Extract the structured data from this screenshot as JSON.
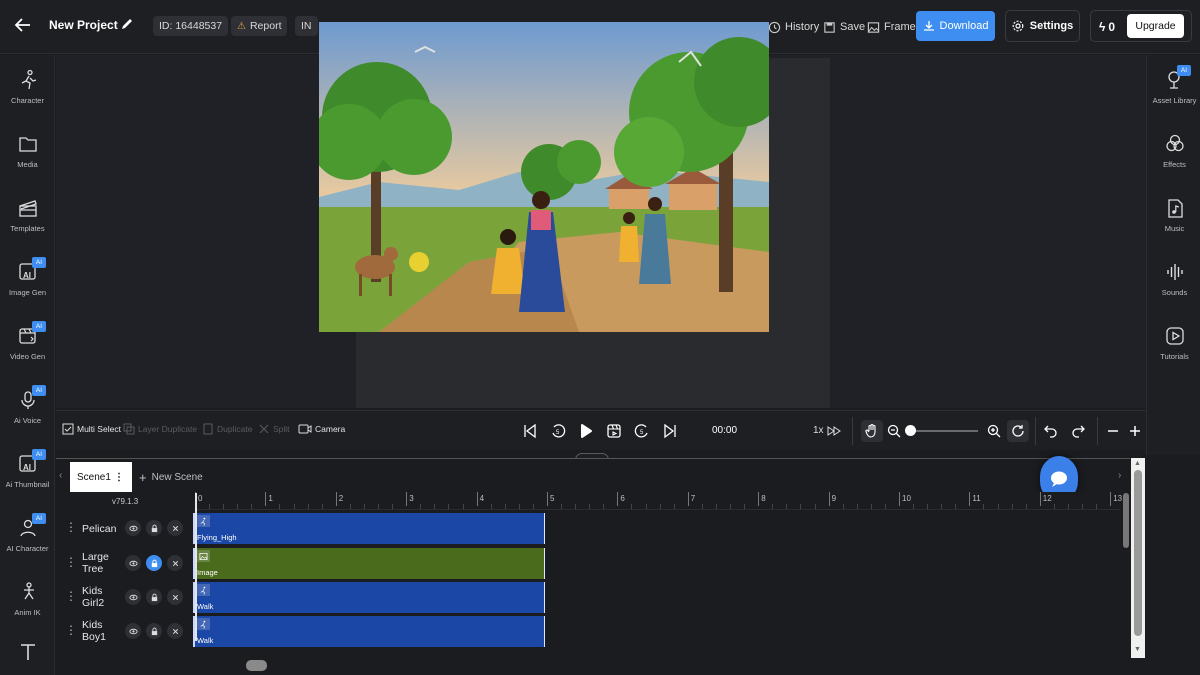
{
  "header": {
    "project_title": "New Project",
    "project_id": "ID: 16448537",
    "report_label": "Report",
    "lang_badge": "IN",
    "history_label": "History",
    "save_label": "Save",
    "frame_label": "Frame",
    "download_label": "Download",
    "settings_label": "Settings",
    "credits": "0",
    "upgrade_label": "Upgrade"
  },
  "left_sidebar": {
    "items": [
      {
        "label": "Character",
        "icon": "running-figure-icon",
        "ai": false
      },
      {
        "label": "Media",
        "icon": "folder-icon",
        "ai": false
      },
      {
        "label": "Templates",
        "icon": "clapperboard-icon",
        "ai": false
      },
      {
        "label": "Image Gen",
        "icon": "image-ai-icon",
        "ai": true
      },
      {
        "label": "Video Gen",
        "icon": "video-ai-icon",
        "ai": true
      },
      {
        "label": "Ai Voice",
        "icon": "microphone-icon",
        "ai": true
      },
      {
        "label": "Ai Thumbnail",
        "icon": "thumbnail-ai-icon",
        "ai": true
      },
      {
        "label": "AI Character",
        "icon": "person-ai-icon",
        "ai": true
      },
      {
        "label": "Anim IK",
        "icon": "ik-figure-icon",
        "ai": false
      },
      {
        "label": "",
        "icon": "text-icon",
        "ai": false
      }
    ],
    "ai_badge": "AI"
  },
  "right_sidebar": {
    "items": [
      {
        "label": "Asset Library",
        "icon": "asset-library-icon",
        "ai": true
      },
      {
        "label": "Effects",
        "icon": "effects-circles-icon",
        "ai": false
      },
      {
        "label": "Music",
        "icon": "music-file-icon",
        "ai": false
      },
      {
        "label": "Sounds",
        "icon": "sound-wave-icon",
        "ai": false
      },
      {
        "label": "Tutorials",
        "icon": "play-tutorial-icon",
        "ai": false
      }
    ]
  },
  "toolbar": {
    "multi_select": "Multi Select",
    "layer_duplicate": "Layer Duplicate",
    "duplicate": "Duplicate",
    "split": "Split",
    "camera": "Camera",
    "time": "00:00",
    "speed": "1x",
    "zoom_level": 0.0
  },
  "scenes": {
    "active": "Scene1",
    "new_scene_label": "New Scene"
  },
  "timeline": {
    "version": "v79.1.3",
    "ruler_ticks": [
      "0",
      "1",
      "2",
      "3",
      "4",
      "5",
      "6",
      "7",
      "8",
      "9",
      "10",
      "11",
      "12",
      "13"
    ],
    "layers": [
      {
        "name_line1": "Pelican",
        "name_line2": "",
        "clip_label": "Flying_High",
        "clip_type": "character",
        "locked": false
      },
      {
        "name_line1": "Large",
        "name_line2": "Tree",
        "clip_label": "Image",
        "clip_type": "image",
        "locked": true
      },
      {
        "name_line1": "Kids",
        "name_line2": "Girl2",
        "clip_label": "Walk",
        "clip_type": "character",
        "locked": false
      },
      {
        "name_line1": "Kids",
        "name_line2": "Boy1",
        "clip_label": "Walk",
        "clip_type": "character",
        "locked": false
      }
    ]
  },
  "colors": {
    "accent": "#3d8ef0",
    "character_clip": "#1b47a6",
    "image_clip": "#4a6a1c",
    "background": "#1b1c20"
  }
}
